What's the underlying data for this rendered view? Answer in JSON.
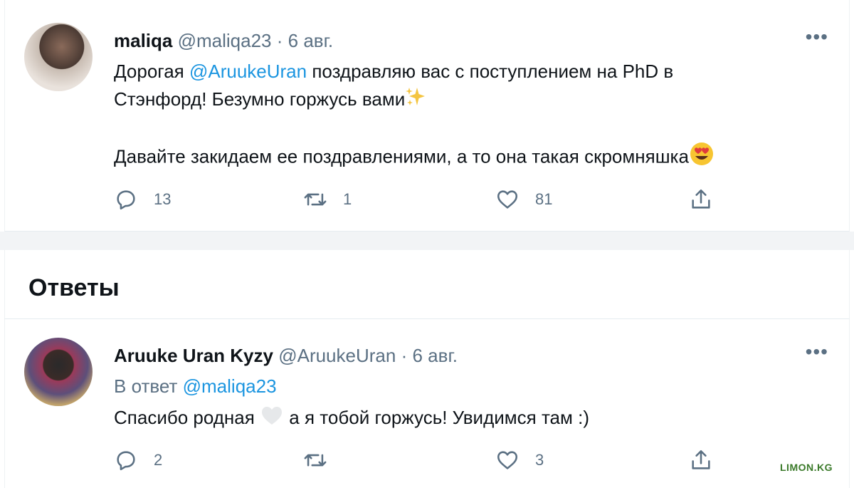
{
  "tweet": {
    "name": "maliqa",
    "handle": "@maliqa23",
    "dot": "·",
    "date": "6 авг.",
    "more": "•••",
    "line1_pre": "Дорогая ",
    "line1_mention": "@AruukeUran",
    "line1_post": " поздравляю вас с поступлением на PhD в",
    "line2": "Стэнфорд! Безумно горжусь вами",
    "line3": "Давайте закидаем ее поздравлениями, а то она такая скромняшка",
    "replies": "13",
    "retweets": "1",
    "likes": "81"
  },
  "replies_section": {
    "title": "Ответы"
  },
  "reply": {
    "name": "Aruuke Uran Kyzy",
    "handle": "@AruukeUran",
    "dot": "·",
    "date": "6 авг.",
    "more": "•••",
    "in_reply_prefix": "В ответ ",
    "in_reply_handle": "@maliqa23",
    "text_pre": "Спасибо родная",
    "text_post": " а я тобой горжусь! Увидимся там :)",
    "replies": "2",
    "retweets": "",
    "likes": "3"
  },
  "watermark": "LIMON.KG",
  "icons": [
    "reply-icon",
    "retweet-icon",
    "like-icon",
    "share-icon",
    "more-icon",
    "sparkles-emoji",
    "heart-eyes-emoji",
    "white-heart-emoji"
  ]
}
